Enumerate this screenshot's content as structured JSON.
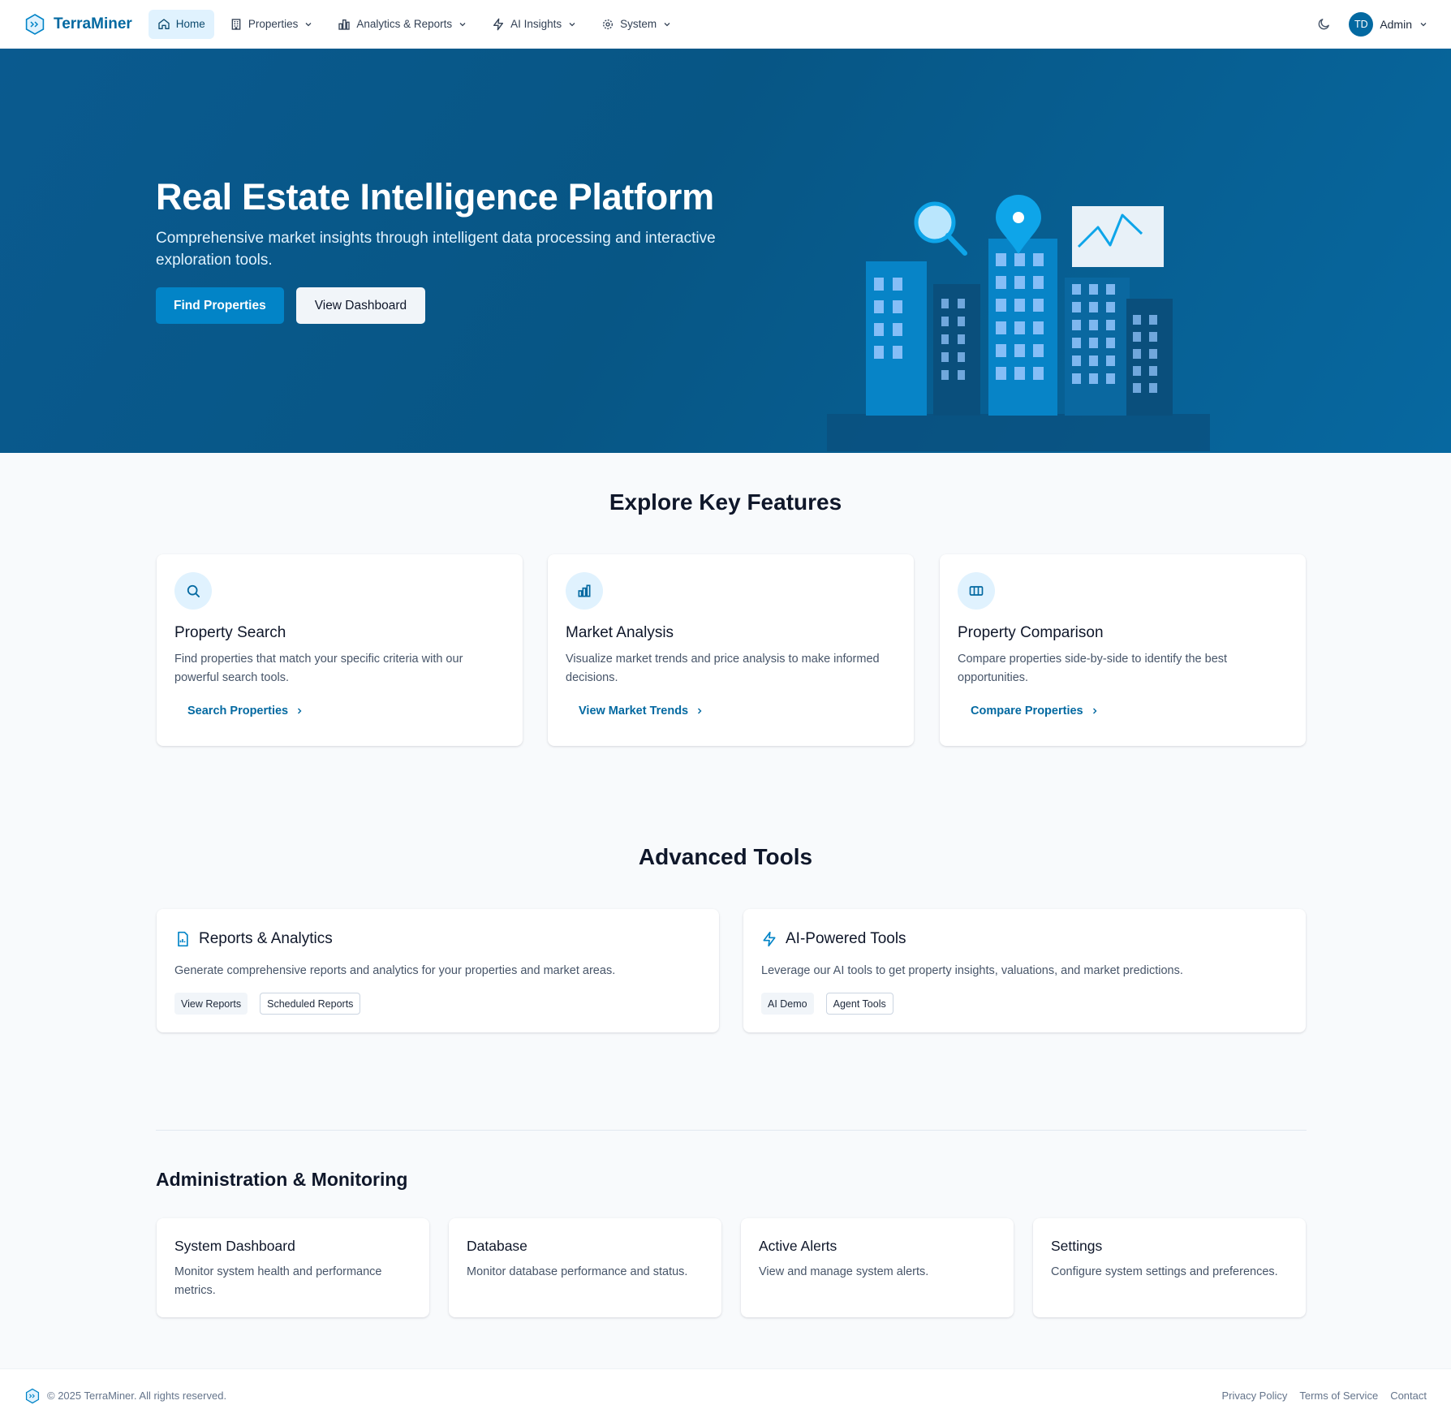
{
  "brand": {
    "name": "TerraMiner",
    "icon": "terraminer-logo-icon"
  },
  "nav": {
    "items": [
      {
        "label": "Home",
        "icon": "home-icon",
        "active": true
      },
      {
        "label": "Properties",
        "icon": "building-icon"
      },
      {
        "label": "Analytics & Reports",
        "icon": "bar-chart-icon"
      },
      {
        "label": "AI Insights",
        "icon": "lightning-icon"
      },
      {
        "label": "System",
        "icon": "gear-icon"
      }
    ],
    "user": {
      "initials": "TD",
      "name": "Admin"
    }
  },
  "hero": {
    "title": "Real Estate Intelligence Platform",
    "subtitle": "Comprehensive market insights through intelligent data processing and interactive exploration tools.",
    "primary_button": "Find Properties",
    "secondary_button": "View Dashboard"
  },
  "features": {
    "title": "Explore Key Features",
    "cards": [
      {
        "icon": "search-icon",
        "title": "Property Search",
        "description": "Find properties that match your specific criteria with our powerful search tools.",
        "link": "Search Properties"
      },
      {
        "icon": "bar-chart-icon",
        "title": "Market Analysis",
        "description": "Visualize market trends and price analysis to make informed decisions.",
        "link": "View Market Trends"
      },
      {
        "icon": "columns-icon",
        "title": "Property Comparison",
        "description": "Compare properties side-by-side to identify the best opportunities.",
        "link": "Compare Properties"
      }
    ]
  },
  "tools": {
    "title": "Advanced Tools",
    "cards": [
      {
        "icon": "report-icon",
        "title": "Reports & Analytics",
        "description": "Generate comprehensive reports and analytics for your properties and market areas.",
        "tags": [
          "View Reports",
          "Scheduled Reports"
        ]
      },
      {
        "icon": "lightning-icon",
        "title": "AI-Powered Tools",
        "description": "Leverage our AI tools to get property insights, valuations, and market predictions.",
        "tags": [
          "AI Demo",
          "Agent Tools"
        ]
      }
    ]
  },
  "admin": {
    "title": "Administration & Monitoring",
    "cards": [
      {
        "title": "System Dashboard",
        "description": "Monitor system health and performance metrics."
      },
      {
        "title": "Database",
        "description": "Monitor database performance and status."
      },
      {
        "title": "Active Alerts",
        "description": "View and manage system alerts."
      },
      {
        "title": "Settings",
        "description": "Configure system settings and preferences."
      }
    ]
  },
  "footer": {
    "copyright": "© 2025 TerraMiner. All rights reserved.",
    "links": [
      "Privacy Policy",
      "Terms of Service",
      "Contact"
    ]
  },
  "colors": {
    "primary": "#0369a1",
    "hero_bg": "#075685",
    "accent": "#0284c7",
    "page_bg": "#f8fafc"
  }
}
